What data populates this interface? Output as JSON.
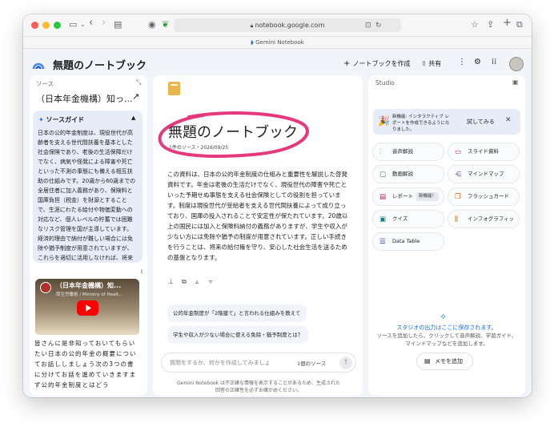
{
  "browser": {
    "url": "notebook.google.com",
    "tab_title": "Gemini Notebook"
  },
  "app": {
    "title": "無題のノートブック",
    "create_label": "ノートブックを作成",
    "share_label": "共有"
  },
  "sources": {
    "header": "ソース",
    "source_title": "（日本年金機構）知っ...",
    "guide_label": "ソースガイド",
    "guide_text": "日本の公的年金制度は、現役世代が高齢者を支える世代間扶養を基本とした社会保険であり、老後の生活保障だけでなく、病気や怪我による障害や死亡といった不測の事態にも備える相互扶助の仕組みです。20歳から60歳までの全居住者に加入義務があり、保険料と国庫負担（税金）を財源とすることで、生涯にわたる給付や物価変動への対応など、個人レベルの貯蓄では困難なリスク管理を国が主導しています。経済的理由で納付が難しい場合には免除や猶予制度が用意されていますが、これらを適切に活用しなければ、将来",
    "video_title": "（日本年金機構）知...",
    "video_channel": "厚生労働省 / Ministry of Healt...",
    "body_text": "皆さんに是非知っておいてもらいたい日本の公的年金の概要についてお話ししましょう次の3つの書に分けてお話を進めていきますまず公的年金制度とはどう"
  },
  "chat": {
    "notebook_title": "無題のノートブック",
    "meta": "1件のソース・2026/09/25",
    "summary": "この資料は、日本の公的年金制度の仕組みと重要性を解説した啓発資料です。年金は老後の生活だけでなく、現役世代の障害や死亡といった予期せぬ事態を支える社会保険としての役割を担っています。制度は現役世代が受給者を支える世代間扶養によって成り立っており、国庫の投入されることで安定性が保たれています。20歳以上の国民には加入と保険料納付の義務がありますが、学生や収入が少ない方には免除や猶予の制度が用意されています。正しい手続きを行うことは、将来の給付権を守り、安心した社会生活を送るための基盤となります。",
    "suggestions": [
      "公的年金制度が「2階建て」と言われる仕組みを教えて",
      "学生や収入が少ない場合に使える免除・猶予制度とは？"
    ],
    "input_placeholder": "質問をするか、何かを作成してみましょ",
    "source_count": "1個のソース",
    "disclaimer": "Gemini Notebook は不正確な情報を表示することがあるため、生成された回答の正確性を必ずお確かめください。"
  },
  "studio": {
    "header": "Studio",
    "banner_text": "新機能: インタラクティブ レポートを作成できるようになりました。",
    "banner_button": "試してみる",
    "tools": [
      {
        "label": "音声解説",
        "icon": "audio-icon",
        "color": "#3f51b5"
      },
      {
        "label": "スライド資料",
        "icon": "slides-icon",
        "color": "#c2185b"
      },
      {
        "label": "動画解説",
        "icon": "video-icon",
        "color": "#2e7d32"
      },
      {
        "label": "マインドマップ",
        "icon": "mindmap-icon",
        "color": "#6d4c9f"
      },
      {
        "label": "レポート",
        "icon": "report-icon",
        "color": "#c2185b",
        "badge": "新機能！"
      },
      {
        "label": "フラッシュカード",
        "icon": "flashcard-icon",
        "color": "#e65100"
      },
      {
        "label": "クイズ",
        "icon": "quiz-icon",
        "color": "#00838f"
      },
      {
        "label": "インフォグラフィッ",
        "icon": "infographic-icon",
        "color": "#bf6a00"
      },
      {
        "label": "Data Table",
        "icon": "datatable-icon",
        "color": "#3949ab"
      }
    ],
    "empty_title": "スタジオの出力はここに保存されます。",
    "empty_desc": "ソースを追加したら、クリックして音声解説、学習ガイド、マインドマップなどを追加します。",
    "memo_button": "メモを追加"
  }
}
